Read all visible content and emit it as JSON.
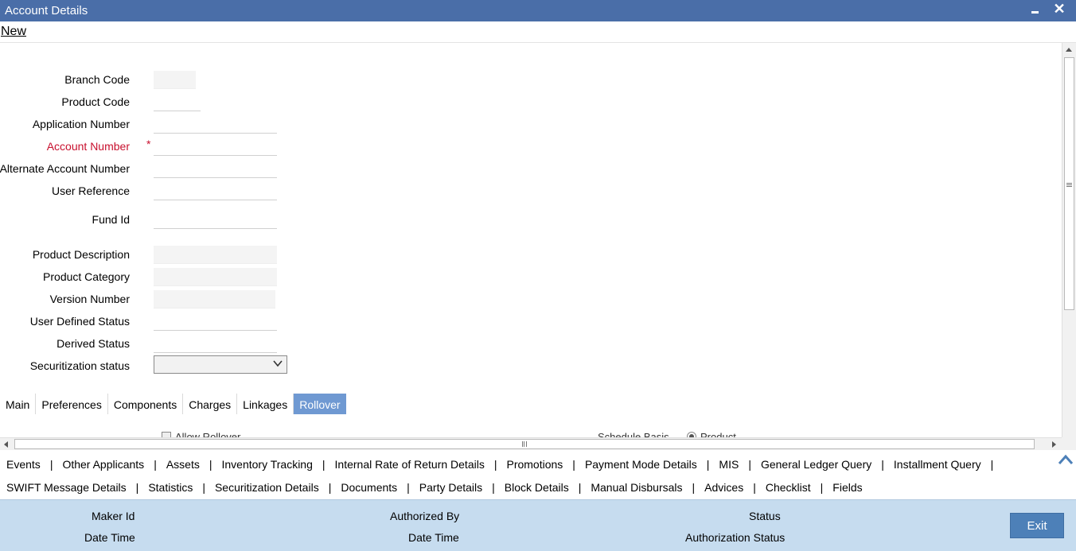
{
  "window": {
    "title": "Account Details"
  },
  "toolbar": {
    "new_label": "New"
  },
  "form": {
    "branch_code_label": "Branch Code",
    "product_code_label": "Product Code",
    "application_number_label": "Application Number",
    "account_number_label": "Account Number",
    "required_marker": "*",
    "alternate_account_number_label": "Alternate Account Number",
    "user_reference_label": "User Reference",
    "fund_id_label": "Fund Id",
    "product_description_label": "Product Description",
    "product_category_label": "Product Category",
    "version_number_label": "Version Number",
    "user_defined_status_label": "User Defined Status",
    "derived_status_label": "Derived Status",
    "securitization_status_label": "Securitization status",
    "securitization_status_value": ""
  },
  "tabs": [
    {
      "label": "Main",
      "active": false
    },
    {
      "label": "Preferences",
      "active": false
    },
    {
      "label": "Components",
      "active": false
    },
    {
      "label": "Charges",
      "active": false
    },
    {
      "label": "Linkages",
      "active": false
    },
    {
      "label": "Rollover",
      "active": true
    }
  ],
  "rollover": {
    "allow_rollover_label": "Allow Rollover",
    "schedule_basis_label": "Schedule Basis",
    "schedule_basis_option": "Product"
  },
  "links_row1": [
    "Events",
    "Other Applicants",
    "Assets",
    "Inventory Tracking",
    "Internal Rate of Return Details",
    "Promotions",
    "Payment Mode Details",
    "MIS",
    "General Ledger Query",
    "Installment Query"
  ],
  "links_row2": [
    "SWIFT Message Details",
    "Statistics",
    "Securitization Details",
    "Documents",
    "Party Details",
    "Block Details",
    "Manual Disbursals",
    "Advices",
    "Checklist",
    "Fields"
  ],
  "link_separator": "|",
  "footer": {
    "maker_id_label": "Maker Id",
    "date_time_label": "Date Time",
    "authorized_by_label": "Authorized By",
    "date_time_label_2": "Date Time",
    "status_label": "Status",
    "authorization_status_label": "Authorization Status",
    "exit_label": "Exit"
  },
  "colors": {
    "titlebar": "#4a6ea8",
    "active_tab": "#6f99d2",
    "required": "#c8102e",
    "footer": "#c6dcef",
    "exit_button": "#4d80b8"
  }
}
